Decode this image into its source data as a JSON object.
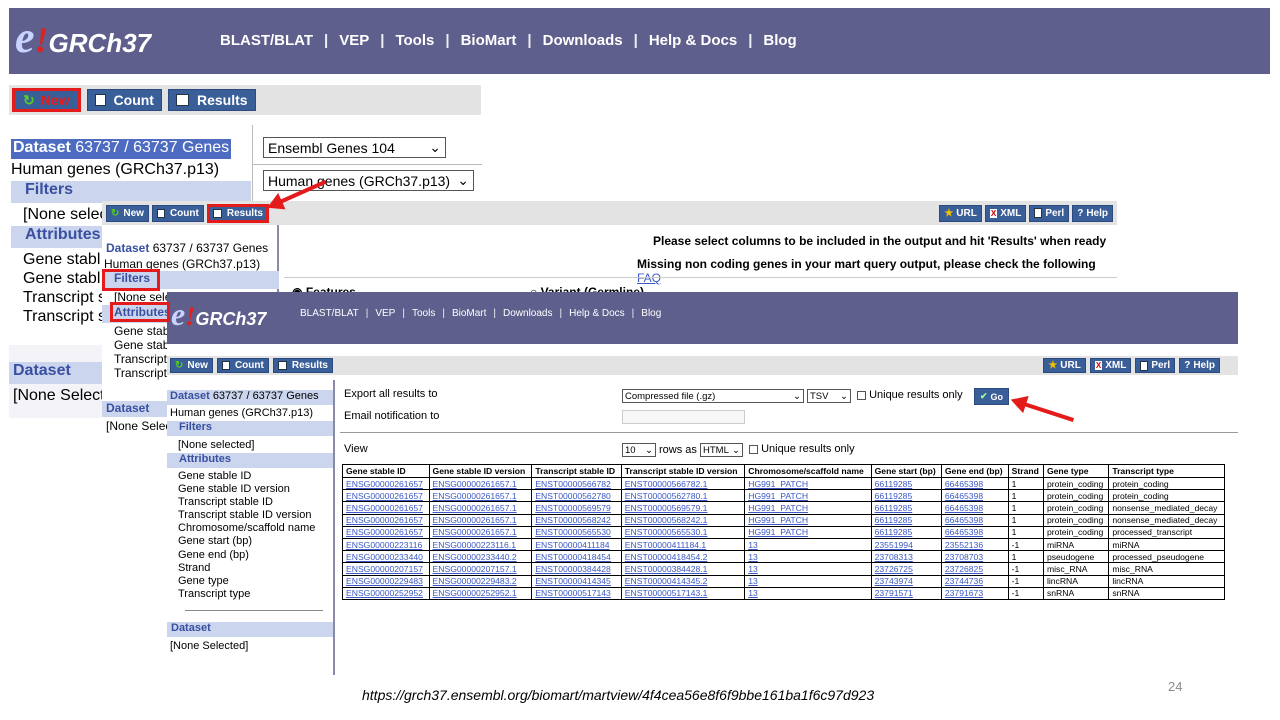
{
  "nav": {
    "links": [
      "BLAST/BLAT",
      "VEP",
      "Tools",
      "BioMart",
      "Downloads",
      "Help & Docs",
      "Blog"
    ],
    "sep": "|",
    "logo_e": "e",
    "logo_bang": "!",
    "logo_text": "GRCh37"
  },
  "buttons": {
    "new": "New",
    "count": "Count",
    "results": "Results",
    "url": "URL",
    "xml": "XML",
    "perl": "Perl",
    "help": "Help",
    "go": "Go"
  },
  "panel1": {
    "dataset_label": "Dataset",
    "dataset_count": "63737 / 63737 Genes",
    "dataset_name": "Human genes (GRCh37.p13)",
    "filters": "Filters",
    "filters_value": "[None selec",
    "attributes": "Attributes",
    "attr_items": [
      "Gene stabl",
      "Gene stabl",
      "Transcript s",
      "Transcript s"
    ],
    "dataset2": "Dataset",
    "dataset2_value": "[None Select",
    "db_select": "Ensembl Genes 104",
    "ds_select": "Human genes (GRCh37.p13)"
  },
  "panel2": {
    "dataset_label": "Dataset",
    "dataset_count": "63737 / 63737 Genes",
    "dataset_name": "Human genes (GRCh37.p13)",
    "filters": "Filters",
    "filters_value": "[None sele",
    "attributes": "Attributes",
    "attr_items": [
      "Gene stab",
      "Gene stab",
      "Transcript",
      "Transcript"
    ],
    "dataset2": "Dataset",
    "dataset2_value": "[None Selec",
    "msg1": "Please select columns to be included in the output and hit 'Results' when ready",
    "msg2": "Missing non coding genes in your mart query output, please check the following",
    "faq": "FAQ",
    "radio1": "Features",
    "radio2": "Variant (Germline)"
  },
  "panel3": {
    "dataset_label": "Dataset",
    "dataset_count": "63737 / 63737 Genes",
    "dataset_name": "Human genes (GRCh37.p13)",
    "filters": "Filters",
    "filters_value": "[None selected]",
    "attributes": "Attributes",
    "attr_items": [
      "Gene stable ID",
      "Gene stable ID version",
      "Transcript stable ID",
      "Transcript stable ID version",
      "Chromosome/scaffold name",
      "Gene start (bp)",
      "Gene end (bp)",
      "Strand",
      "Gene type",
      "Transcript type"
    ],
    "dataset2": "Dataset",
    "dataset2_value": "[None Selected]",
    "export_label": "Export  all results to",
    "export_format": "Compressed file (.gz)",
    "export_type": "TSV",
    "unique_label": "Unique results only",
    "email_label": "Email notification to",
    "view_label": "View",
    "rows_value": "10",
    "rows_as": "rows as",
    "view_format": "HTML",
    "unique_label2": "Unique results only"
  },
  "table": {
    "headers": [
      "Gene stable ID",
      "Gene stable ID version",
      "Transcript stable ID",
      "Transcript stable ID version",
      "Chromosome/scaffold name",
      "Gene start (bp)",
      "Gene end (bp)",
      "Strand",
      "Gene type",
      "Transcript type"
    ],
    "rows": [
      [
        "ENSG00000261657",
        "ENSG00000261657.1",
        "ENST00000566782",
        "ENST00000566782.1",
        "HG991_PATCH",
        "66119285",
        "66465398",
        "1",
        "protein_coding",
        "protein_coding"
      ],
      [
        "ENSG00000261657",
        "ENSG00000261657.1",
        "ENST00000562780",
        "ENST00000562780.1",
        "HG991_PATCH",
        "66119285",
        "66465398",
        "1",
        "protein_coding",
        "protein_coding"
      ],
      [
        "ENSG00000261657",
        "ENSG00000261657.1",
        "ENST00000569579",
        "ENST00000569579.1",
        "HG991_PATCH",
        "66119285",
        "66465398",
        "1",
        "protein_coding",
        "nonsense_mediated_decay"
      ],
      [
        "ENSG00000261657",
        "ENSG00000261657.1",
        "ENST00000568242",
        "ENST00000568242.1",
        "HG991_PATCH",
        "66119285",
        "66465398",
        "1",
        "protein_coding",
        "nonsense_mediated_decay"
      ],
      [
        "ENSG00000261657",
        "ENSG00000261657.1",
        "ENST00000565530",
        "ENST00000565530.1",
        "HG991_PATCH",
        "66119285",
        "66465398",
        "1",
        "protein_coding",
        "processed_transcript"
      ],
      [
        "ENSG00000223116",
        "ENSG00000223116.1",
        "ENST00000411184",
        "ENST00000411184.1",
        "13",
        "23551994",
        "23552136",
        "-1",
        "miRNA",
        "miRNA"
      ],
      [
        "ENSG00000233440",
        "ENSG00000233440.2",
        "ENST00000418454",
        "ENST00000418454.2",
        "13",
        "23708313",
        "23708703",
        "1",
        "pseudogene",
        "processed_pseudogene"
      ],
      [
        "ENSG00000207157",
        "ENSG00000207157.1",
        "ENST00000384428",
        "ENST00000384428.1",
        "13",
        "23726725",
        "23726825",
        "-1",
        "misc_RNA",
        "misc_RNA"
      ],
      [
        "ENSG00000229483",
        "ENSG00000229483.2",
        "ENST00000414345",
        "ENST00000414345.2",
        "13",
        "23743974",
        "23744736",
        "-1",
        "lincRNA",
        "lincRNA"
      ],
      [
        "ENSG00000252952",
        "ENSG00000252952.1",
        "ENST00000517143",
        "ENST00000517143.1",
        "13",
        "23791571",
        "23791673",
        "-1",
        "snRNA",
        "snRNA"
      ]
    ]
  },
  "footer": {
    "url": "https://grch37.ensembl.org/biomart/martview/4f4cea56e8f6f9bbe161ba1f6c97d923",
    "page": "24"
  },
  "colors": {
    "banner": "#5f5f8d",
    "button": "#3a5e98",
    "highlight": "#e31b1b",
    "link": "#3b58c4"
  }
}
